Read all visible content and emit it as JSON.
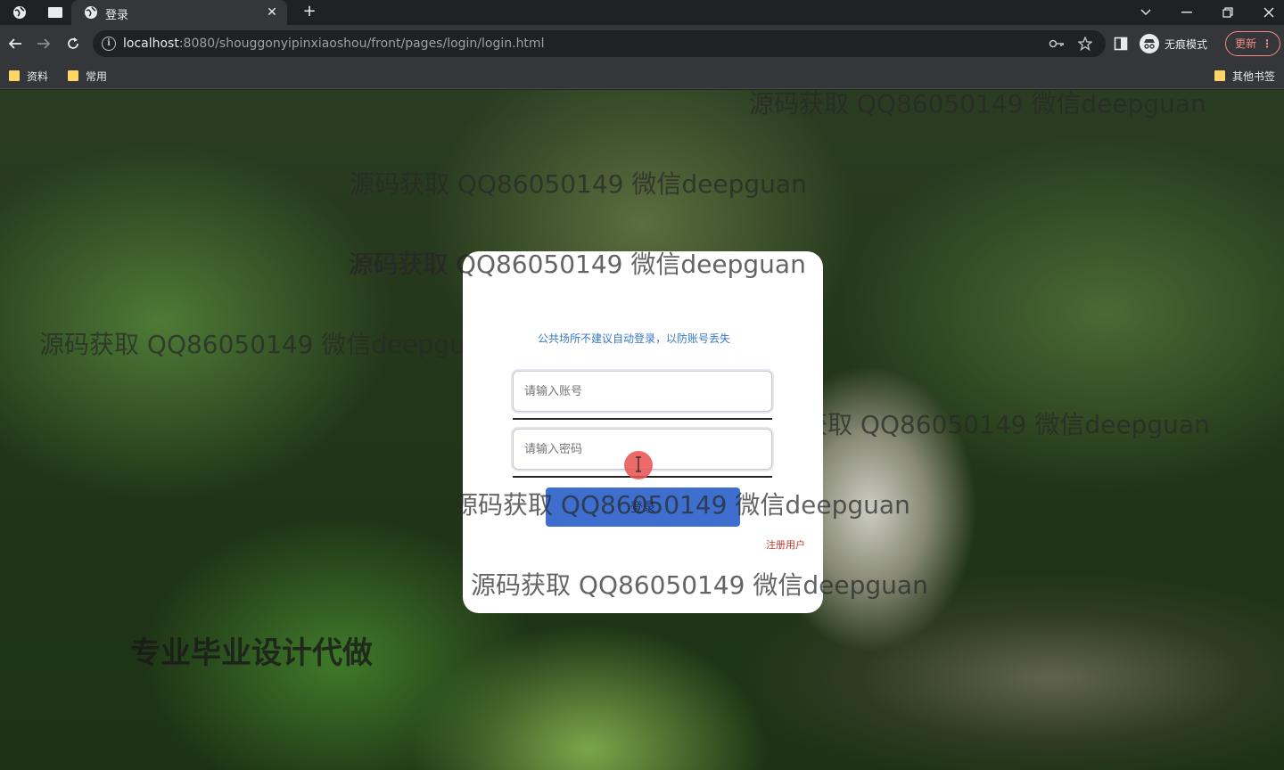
{
  "browser": {
    "tab_title": "登录",
    "url_host": "localhost",
    "url_rest": ":8080/shouggonyipinxiaoshou/front/pages/login/login.html",
    "incognito_label": "无痕模式",
    "update_label": "更新",
    "bookmarks": [
      "资料",
      "常用"
    ],
    "other_bookmarks": "其他书签"
  },
  "login": {
    "tip": "公共场所不建议自动登录，以防账号丢失",
    "username_placeholder": "请输入账号",
    "password_placeholder": "请输入密码",
    "login_label": "登录",
    "register_label": "注册用户"
  },
  "watermarks": {
    "line": "源码获取 QQ86050149 微信deepguan",
    "short": "源码获取 QQ86050149 微信deepguan",
    "banner": "专业毕业设计代做"
  }
}
